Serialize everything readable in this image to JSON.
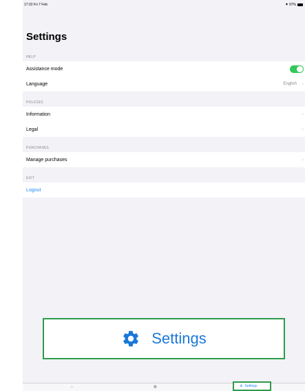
{
  "status_bar": {
    "time": "17:22",
    "date": "Fri 7 Feb",
    "battery": "97%"
  },
  "page": {
    "title": "Settings"
  },
  "sections": {
    "help": {
      "header": "HELP",
      "assistance_mode": {
        "label": "Assistance mode",
        "enabled": true
      },
      "language": {
        "label": "Language",
        "value": "English"
      }
    },
    "policies": {
      "header": "POLICIES",
      "information": {
        "label": "Information"
      },
      "legal": {
        "label": "Legal"
      }
    },
    "purchases": {
      "header": "PURCHASES",
      "manage": {
        "label": "Manage purchases"
      }
    },
    "exit": {
      "header": "EXIT",
      "logout": {
        "label": "Logout"
      }
    }
  },
  "highlight": {
    "label": "Settings",
    "icon": "gear-icon"
  },
  "tabbar": {
    "tabs": [
      {
        "label": "",
        "icon": "home-icon"
      },
      {
        "label": "",
        "icon": "grid-icon"
      },
      {
        "label": "Settings",
        "icon": "gear-icon"
      }
    ]
  },
  "colors": {
    "accent": "#1a8cff",
    "toggle_on": "#34c759",
    "highlight_border": "#2e9a4a",
    "background": "#f2f2f7"
  }
}
